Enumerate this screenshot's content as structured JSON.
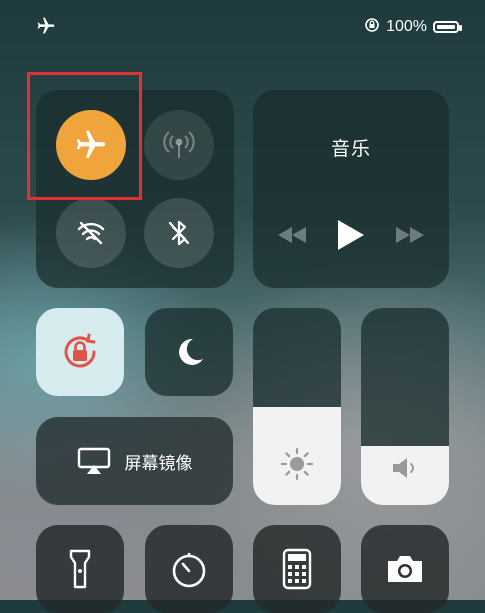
{
  "status_bar": {
    "left_icon": "airplane-icon",
    "battery_percent": "100%"
  },
  "connectivity": {
    "airplane_mode": true,
    "cellular_data": false,
    "wifi": false,
    "bluetooth": false
  },
  "music": {
    "title": "音乐"
  },
  "rotation_lock": {
    "active": true
  },
  "do_not_disturb": {
    "active": false
  },
  "screen_mirroring": {
    "label": "屏幕镜像"
  },
  "brightness": {
    "level": 0.5
  },
  "volume": {
    "level": 0.3
  },
  "colors": {
    "airplane_active": "#f0a53c",
    "rotation_tile": "#d6ecef",
    "rotation_icon": "#e0524a",
    "highlight_box": "#e0332f"
  }
}
